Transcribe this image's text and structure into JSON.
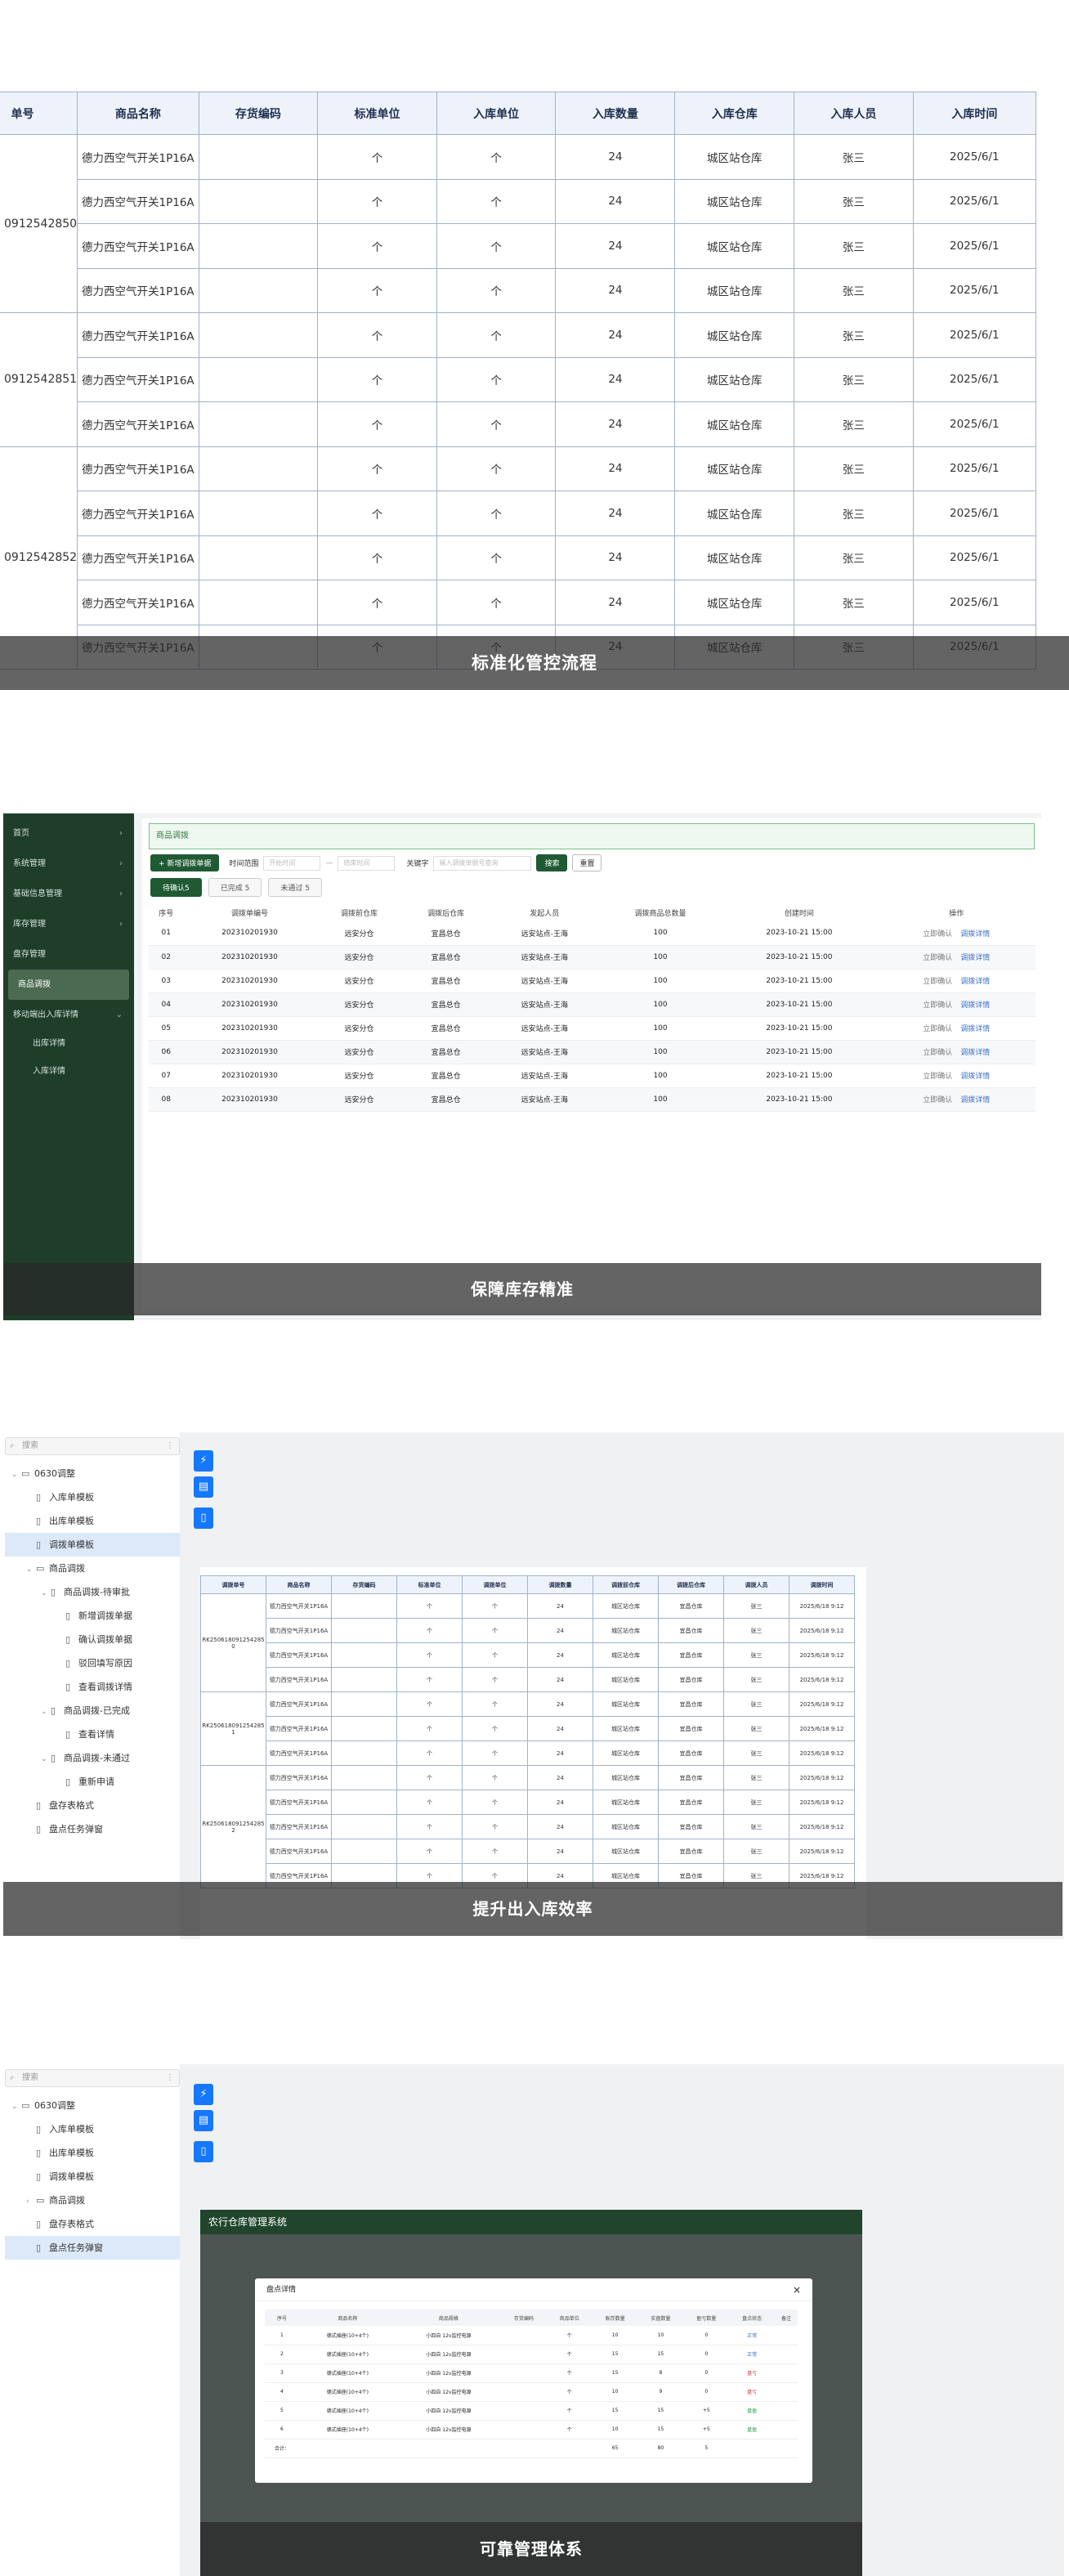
{
  "panel1": {
    "headers": [
      "单号",
      "商品名称",
      "存货编码",
      "标准单位",
      "入库单位",
      "入库数量",
      "入库仓库",
      "入库人员",
      "入库时间"
    ],
    "groups": [
      {
        "id": "0912542850",
        "rows": 4
      },
      {
        "id": "0912542851",
        "rows": 3
      },
      {
        "id": "0912542852",
        "rows": 5
      }
    ],
    "row": {
      "name": "德力西空气开关1P16A",
      "code": "",
      "std_unit": "个",
      "in_unit": "个",
      "qty": "24",
      "warehouse": "城区站仓库",
      "person": "张三",
      "time": "2025/6/1"
    },
    "caption": "标准化管控流程"
  },
  "panel2": {
    "sidebar": [
      {
        "label": "首页",
        "chev": "›"
      },
      {
        "label": "系统管理",
        "chev": "›"
      },
      {
        "label": "基础信息管理",
        "chev": "›"
      },
      {
        "label": "库存管理",
        "chev": "›"
      },
      {
        "label": "盘存管理",
        "chev": ""
      },
      {
        "label": "商品调拨",
        "chev": "",
        "active": true
      },
      {
        "label": "移动端出入库详情",
        "chev": "⌄"
      }
    ],
    "sidebar_sub": [
      "出库详情",
      "入库详情"
    ],
    "crumb": "商品调拨",
    "new_btn": "+ 新增调拨单据",
    "time_label": "时间范围",
    "date_from": "开始时间",
    "date_sep": "—",
    "date_to": "结束时间",
    "kw_label": "关键字",
    "kw_placeholder": "输入调拨单据号查询",
    "search_btn": "搜索",
    "reset_btn": "重置",
    "tabs": [
      "待确认5",
      "已完成 5",
      "未通过 5"
    ],
    "headers": [
      "序号",
      "调拨单编号",
      "调拨前仓库",
      "调拨后仓库",
      "发起人员",
      "调拨商品总数量",
      "创建时间",
      "操作"
    ],
    "rows": [
      [
        "01",
        "202310201930",
        "远安分仓",
        "宜昌总仓",
        "远安站点-王海",
        "100",
        "2023-10-21 15:00"
      ],
      [
        "02",
        "202310201930",
        "远安分仓",
        "宜昌总仓",
        "远安站点-王海",
        "100",
        "2023-10-21 15:00"
      ],
      [
        "03",
        "202310201930",
        "远安分仓",
        "宜昌总仓",
        "远安站点-王海",
        "100",
        "2023-10-21 15:00"
      ],
      [
        "04",
        "202310201930",
        "远安分仓",
        "宜昌总仓",
        "远安站点-王海",
        "100",
        "2023-10-21 15:00"
      ],
      [
        "05",
        "202310201930",
        "远安分仓",
        "宜昌总仓",
        "远安站点-王海",
        "100",
        "2023-10-21 15:00"
      ],
      [
        "06",
        "202310201930",
        "远安分仓",
        "宜昌总仓",
        "远安站点-王海",
        "100",
        "2023-10-21 15:00"
      ],
      [
        "07",
        "202310201930",
        "远安分仓",
        "宜昌总仓",
        "远安站点-王海",
        "100",
        "2023-10-21 15:00"
      ],
      [
        "08",
        "202310201930",
        "远安分仓",
        "宜昌总仓",
        "远安站点-王海",
        "100",
        "2023-10-21 15:00"
      ]
    ],
    "op1": "立即确认",
    "op2": "调拨详情",
    "caption": "保障库存精准"
  },
  "panel3": {
    "search": "搜索",
    "tree": [
      {
        "label": "0630调整",
        "indent": 0,
        "icon": "folder",
        "arrow": "⌄"
      },
      {
        "label": "入库单模板",
        "indent": 1,
        "icon": "file"
      },
      {
        "label": "出库单模板",
        "indent": 1,
        "icon": "file"
      },
      {
        "label": "调拨单模板",
        "indent": 1,
        "icon": "file",
        "sel": true
      },
      {
        "label": "商品调拨",
        "indent": 1,
        "icon": "folder",
        "arrow": "⌄"
      },
      {
        "label": "商品调拨-待审批",
        "indent": 2,
        "icon": "file",
        "arrow": "⌄"
      },
      {
        "label": "新增调拨单据",
        "indent": 3,
        "icon": "file"
      },
      {
        "label": "确认调拨单据",
        "indent": 3,
        "icon": "file"
      },
      {
        "label": "驳回填写原因",
        "indent": 3,
        "icon": "file"
      },
      {
        "label": "查看调拨详情",
        "indent": 3,
        "icon": "file"
      },
      {
        "label": "商品调拨-已完成",
        "indent": 2,
        "icon": "file",
        "arrow": "⌄"
      },
      {
        "label": "查看详情",
        "indent": 3,
        "icon": "file"
      },
      {
        "label": "商品调拨-未通过",
        "indent": 2,
        "icon": "file",
        "arrow": "⌄"
      },
      {
        "label": "重新申请",
        "indent": 3,
        "icon": "file"
      },
      {
        "label": "盘存表格式",
        "indent": 1,
        "icon": "file"
      },
      {
        "label": "盘点任务弹窗",
        "indent": 1,
        "icon": "file"
      }
    ],
    "headers": [
      "调拨单号",
      "商品名称",
      "存货编码",
      "标准单位",
      "调拨单位",
      "调拨数量",
      "调拨前仓库",
      "调拨后仓库",
      "调拨人员",
      "调拨时间"
    ],
    "groups": [
      {
        "id": "RK250618091254285\n0",
        "rows": 4
      },
      {
        "id": "RK250618091254285\n1",
        "rows": 3
      },
      {
        "id": "RK250618091254285\n2",
        "rows": 5
      }
    ],
    "row": [
      "德力西空气开关1P16A",
      "",
      "个",
      "个",
      "24",
      "城区站仓库",
      "宜昌仓库",
      "张三",
      "2025/6/18 9:12"
    ],
    "caption": "提升出入库效率"
  },
  "panel4": {
    "search": "搜索",
    "tree": [
      {
        "label": "0630调整",
        "indent": 0,
        "icon": "folder",
        "arrow": "⌄"
      },
      {
        "label": "入库单模板",
        "indent": 1,
        "icon": "file"
      },
      {
        "label": "出库单模板",
        "indent": 1,
        "icon": "file"
      },
      {
        "label": "调拨单模板",
        "indent": 1,
        "icon": "file"
      },
      {
        "label": "商品调拨",
        "indent": 1,
        "icon": "folder",
        "arrow": "›"
      },
      {
        "label": "盘存表格式",
        "indent": 1,
        "icon": "file"
      },
      {
        "label": "盘点任务弹窗",
        "indent": 1,
        "icon": "file",
        "sel": true
      }
    ],
    "app_title": "农行仓库管理系统",
    "modal_title": "盘点详情",
    "modal_close": "×",
    "headers": [
      "序号",
      "商品名称",
      "商品规格",
      "存货编码",
      "商品单位",
      "账存数量",
      "实盘数量",
      "盈亏数量",
      "盘点状态",
      "备注"
    ],
    "rows": [
      [
        "1",
        "德式插座(10+4个)",
        "小四自 12v监控电源",
        "",
        "个",
        "10",
        "10",
        "0",
        "正常",
        ""
      ],
      [
        "2",
        "德式插座(10+4个)",
        "小四自 12v监控电源",
        "",
        "个",
        "15",
        "15",
        "0",
        "正常",
        ""
      ],
      [
        "3",
        "德式插座(10+4个)",
        "小四自 12v监控电源",
        "",
        "个",
        "15",
        "8",
        "0",
        "盘亏",
        ""
      ],
      [
        "4",
        "德式插座(10+4个)",
        "小四自 12v监控电源",
        "",
        "个",
        "10",
        "9",
        "0",
        "盘亏",
        ""
      ],
      [
        "5",
        "德式插座(10+4个)",
        "小四自 12v监控电源",
        "",
        "个",
        "15",
        "15",
        "+5",
        "盘盈",
        ""
      ],
      [
        "6",
        "德式插座(10+4个)",
        "小四自 12v监控电源",
        "",
        "个",
        "10",
        "15",
        "+5",
        "盘盈",
        ""
      ]
    ],
    "total_label": "合计：",
    "totals": [
      "",
      "",
      "",
      "",
      "",
      "65",
      "80",
      "5",
      "",
      ""
    ],
    "status_colors": {
      "正常": "#3a6fc4",
      "盘亏": "#d9363e",
      "盘盈": "#2f9a46"
    },
    "caption": "可靠管理体系"
  }
}
